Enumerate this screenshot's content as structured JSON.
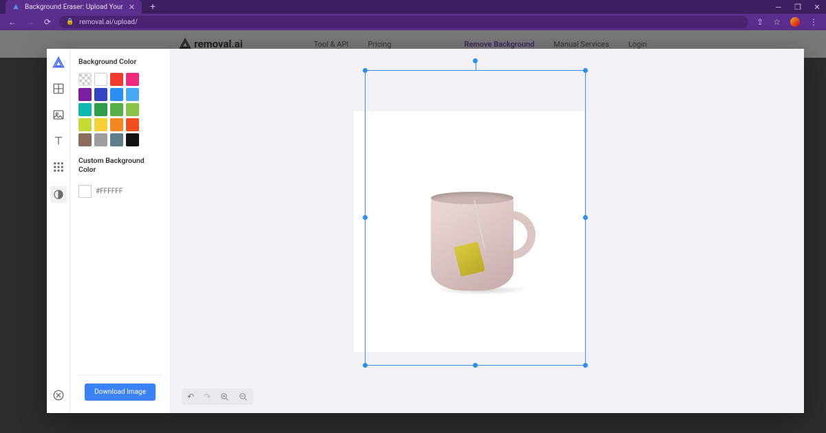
{
  "browser": {
    "tab_title": "Background Eraser: Upload Your",
    "url": "removal.ai/upload/",
    "window_controls": {
      "minimize": "−",
      "maximize": "▢",
      "close": "✕"
    }
  },
  "backdrop_nav": {
    "brand": "removal.ai",
    "links": [
      "Tool & API",
      "Pricing",
      "Remove Background",
      "Manual Services",
      "Login"
    ]
  },
  "sidebar": {
    "section1_title": "Background Color",
    "swatches": [
      "transparent",
      "#ffffff",
      "#f03b2d",
      "#ec297b",
      "#7b1fa2",
      "#3445c2",
      "#2a8ff4",
      "#4ba8f5",
      "#0fb8b0",
      "#2e9c49",
      "#54b147",
      "#8bc34a",
      "#c6d935",
      "#f7d038",
      "#f5871f",
      "#f24e1e",
      "#8a6d5b",
      "#9e9e9e",
      "#607d8b",
      "#111111"
    ],
    "section2_title": "Custom Background Color",
    "custom_hex": "#FFFFFF",
    "download_label": "Download Image"
  },
  "tools": {
    "rail": [
      "logo",
      "grid",
      "image",
      "text",
      "pattern",
      "contrast"
    ]
  },
  "canvas": {
    "subject": "pink-mug-with-teabag",
    "bg_color": "#FFFFFF",
    "controls": [
      "undo",
      "redo",
      "zoom-in",
      "zoom-out"
    ]
  }
}
